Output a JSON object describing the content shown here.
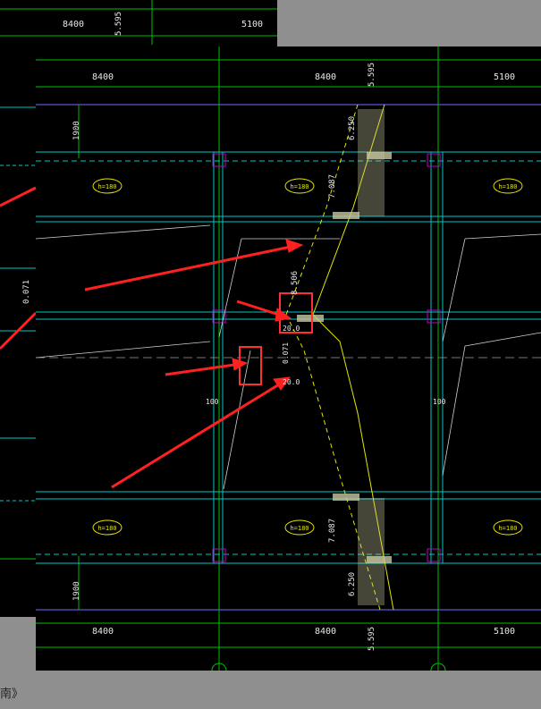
{
  "background": {
    "caption": "南》",
    "dims": {
      "top_left": "8400",
      "top_right": "5100",
      "elev_top": "5.595",
      "side": "1900",
      "elev_mid": "0.071"
    }
  },
  "cad": {
    "dims": {
      "top_left": "8400",
      "top_mid": "8400",
      "top_right": "5100",
      "bottom_left": "8400",
      "bottom_mid": "8400",
      "bottom_right": "5100",
      "side_top": "1900",
      "side_bottom": "1900",
      "left_mid": "100",
      "right_mid": "100"
    },
    "elevations": {
      "top_main": "5.595",
      "top_landing": "6.250",
      "upper_flight": "7.087",
      "mid": "8.506",
      "mid_lower": "20.0",
      "mid_lower2": "20.0",
      "tilt": "0.071",
      "lower_flight": "7.087",
      "bottom_landing": "6.250",
      "bottom_main": "5.595"
    },
    "slab_tags": [
      "h=180",
      "h=180",
      "h=180",
      "h=180",
      "h=180",
      "h=180"
    ]
  },
  "colors": {
    "grid": "#00c000",
    "beam": "#00c8c8",
    "stair": "#e6e600",
    "column": "#c000c0",
    "arrow": "#ff2020",
    "box": "#ff3030",
    "text": "#e8e8e8"
  }
}
